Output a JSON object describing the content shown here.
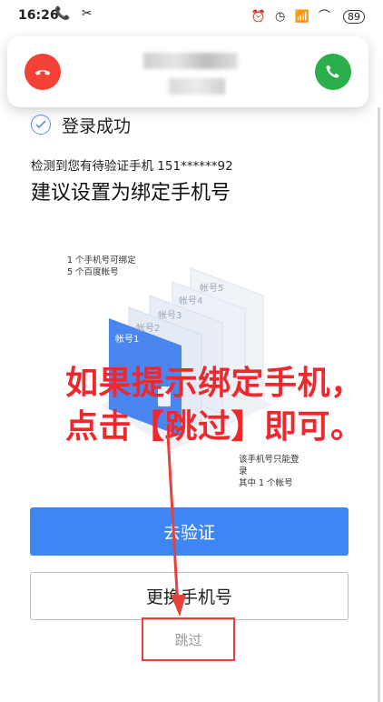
{
  "status_bar": {
    "time": "16:26",
    "left_icons": "📞 ✂",
    "right_icons": "⏰ ◷ 📶 ⌒",
    "battery": "89"
  },
  "call_card": {
    "decline_icon": "phone-hangup-icon",
    "accept_icon": "phone-answer-icon",
    "decline_color": "#f44236",
    "accept_color": "#29b04b"
  },
  "login": {
    "success_text": "登录成功",
    "detect_text": "检测到您有待验证手机 151******92",
    "title": "建议设置为绑定手机号"
  },
  "illustration": {
    "label_top": [
      "1 个手机号可绑定",
      "5 个百度帐号"
    ],
    "label_bottom": [
      "该手机号只能登录",
      "其中 1 个帐号"
    ],
    "cards": [
      "帐号1",
      "帐号2",
      "帐号3",
      "帐号4",
      "帐号5"
    ]
  },
  "annotation": {
    "line1": "如果提示绑定手机，",
    "line2": "点击【跳过】即可。",
    "color": "#f0282d"
  },
  "buttons": {
    "verify": "去验证",
    "change_phone": "更换手机号",
    "skip": "跳过"
  },
  "colors": {
    "primary": "#3e86f5"
  }
}
